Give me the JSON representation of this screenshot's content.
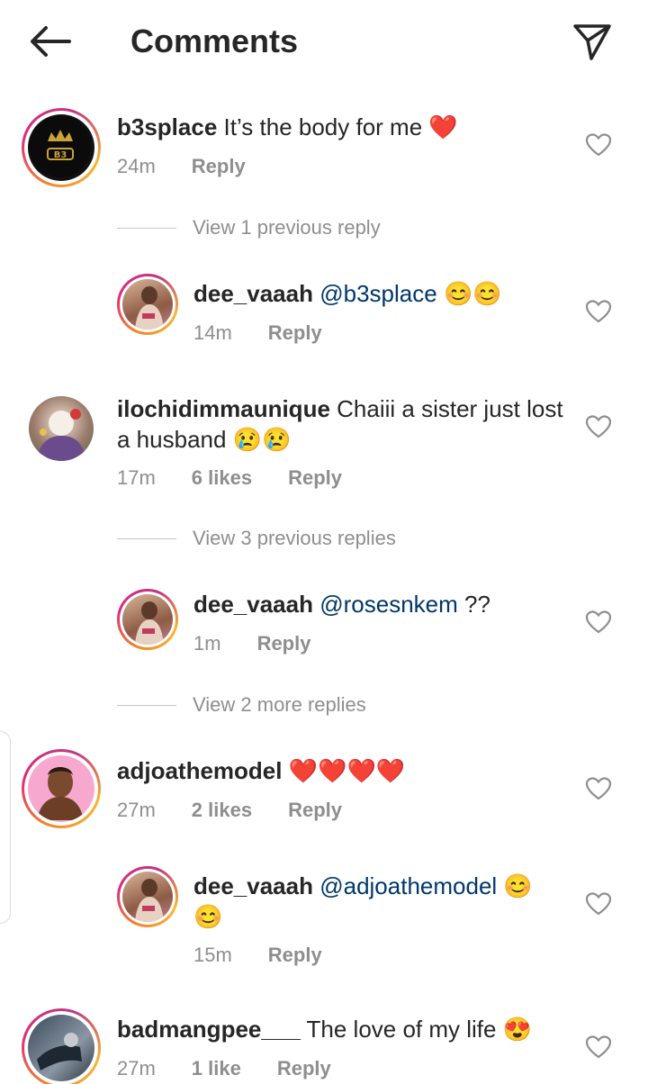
{
  "header": {
    "title": "Comments"
  },
  "comments": [
    {
      "user": "b3splace",
      "text": "It’s the body for me",
      "emoji": "❤️",
      "time": "24m",
      "likes": "",
      "reply": "Reply"
    },
    {
      "user": "dee_vaaah",
      "mention": "@b3splace",
      "text": "",
      "emoji": "😊😊",
      "time": "14m",
      "likes": "",
      "reply": "Reply"
    },
    {
      "user": "ilochidimmaunique",
      "text": "Chaiii a sister just lost a husband",
      "emoji": "😢😢",
      "time": "17m",
      "likes": "6 likes",
      "reply": "Reply"
    },
    {
      "user": "dee_vaaah",
      "mention": "@rosesnkem",
      "text": "??",
      "emoji": "",
      "time": "1m",
      "likes": "",
      "reply": "Reply"
    },
    {
      "user": "adjoathemodel",
      "text": "",
      "emoji": "❤️❤️❤️❤️",
      "time": "27m",
      "likes": "2 likes",
      "reply": "Reply"
    },
    {
      "user": "dee_vaaah",
      "mention": "@adjoathemodel",
      "text": "",
      "emoji": "😊😊",
      "time": "15m",
      "likes": "",
      "reply": "Reply"
    },
    {
      "user": "badmangpee___",
      "text": "The love of my life",
      "emoji": "😍",
      "time": "27m",
      "likes": "1 like",
      "reply": "Reply"
    }
  ],
  "view_replies": [
    "View 1 previous reply",
    "View 3 previous replies",
    "View 2 more replies"
  ],
  "avatars": {
    "b3splace_logo": "B3"
  },
  "icons": {
    "back": "back-arrow-icon",
    "send": "paper-plane-icon",
    "like": "heart-outline-icon"
  },
  "colors": {
    "mention": "#00376b",
    "secondary": "#8e8e8e",
    "heart_red": "#e0142c"
  }
}
